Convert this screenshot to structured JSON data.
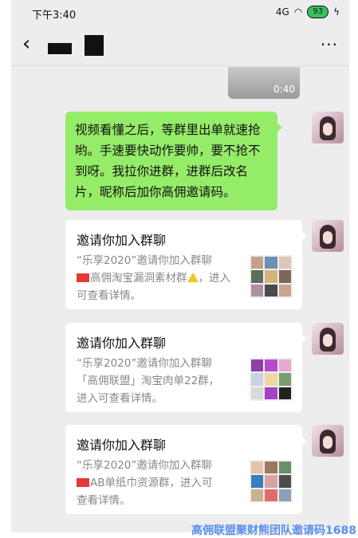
{
  "status": {
    "time": "下午3:40",
    "signal": "4G",
    "battery": "93"
  },
  "header": {
    "back": "‹",
    "more": "···"
  },
  "video": {
    "duration": "0:40"
  },
  "message": {
    "text": "视频看懂之后，等群里出单就速抢哟。手速要快动作要帅，要不抢不到呀。我拉你进群，进群后改名片，昵称后加你高佣邀请码。"
  },
  "cards": [
    {
      "title": "邀请你加入群聊",
      "desc_pre": "“乐享2020”邀请你加入群聊",
      "desc_main": "高佣淘宝漏洞素材群",
      "desc_post": "，进入可查看详情。",
      "flag": true,
      "warn": true
    },
    {
      "title": "邀请你加入群聊",
      "desc_pre": "“乐享2020”邀请你加入群聊",
      "desc_main": "「高佣联盟」淘宝肉单22群，",
      "desc_post": "进入可查看详情。",
      "flag": false,
      "warn": false
    },
    {
      "title": "邀请你加入群聊",
      "desc_pre": "“乐享2020”邀请你加入群聊",
      "desc_main": "AB单纸巾资源群，进入可",
      "desc_post": "查看详情。",
      "flag": true,
      "warn": false
    }
  ],
  "watermark": "高佣联盟聚财熊团队邀请码1688",
  "colors": {
    "chat_bg": "#ededed",
    "bubble": "#95ec69",
    "watermark": "#5b8ff0"
  }
}
